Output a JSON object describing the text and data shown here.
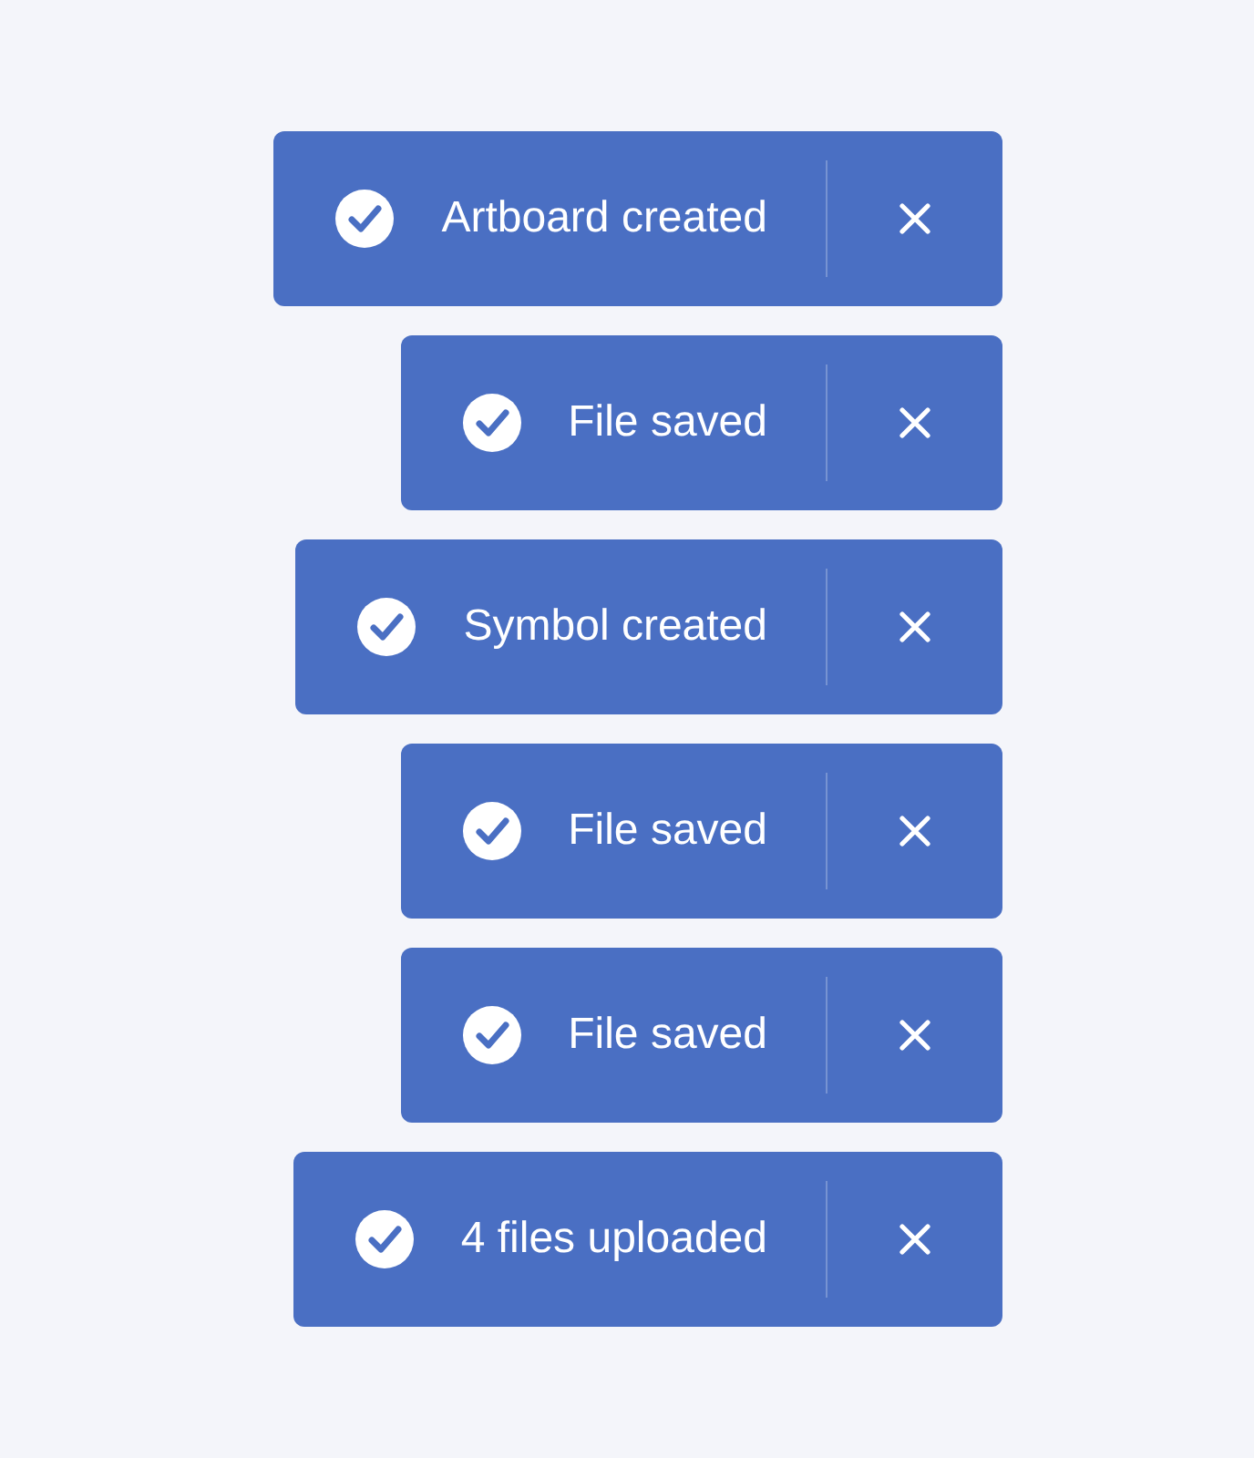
{
  "toasts": [
    {
      "message": "Artboard created"
    },
    {
      "message": "File saved"
    },
    {
      "message": "Symbol created"
    },
    {
      "message": "File saved"
    },
    {
      "message": "File saved"
    },
    {
      "message": "4 files uploaded"
    }
  ]
}
